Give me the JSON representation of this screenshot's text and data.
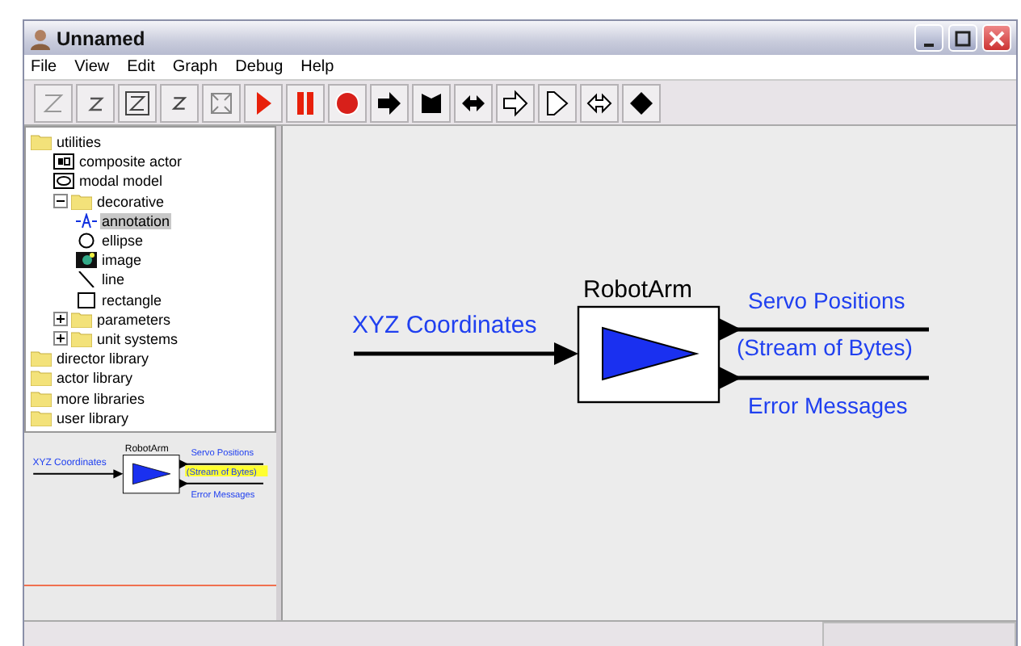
{
  "window": {
    "title": "Unnamed"
  },
  "menu": [
    "File",
    "View",
    "Edit",
    "Graph",
    "Debug",
    "Help"
  ],
  "library_tree": [
    {
      "label": "utilities",
      "kind": "folder",
      "selected": false,
      "children": [
        {
          "label": "composite actor",
          "kind": "composite",
          "selected": false
        },
        {
          "label": "modal model",
          "kind": "modal",
          "selected": false
        },
        {
          "label": "decorative",
          "kind": "folder",
          "expanded": true,
          "selected": false,
          "children": [
            {
              "label": "annotation",
              "kind": "annotation",
              "selected": true
            },
            {
              "label": "ellipse",
              "kind": "ellipse",
              "selected": false
            },
            {
              "label": "image",
              "kind": "image",
              "selected": false
            },
            {
              "label": "line",
              "kind": "line",
              "selected": false
            },
            {
              "label": "rectangle",
              "kind": "rectangle",
              "selected": false
            }
          ]
        },
        {
          "label": "parameters",
          "kind": "folder",
          "expanded": false,
          "selected": false
        },
        {
          "label": "unit systems",
          "kind": "folder",
          "expanded": false,
          "selected": false
        }
      ]
    },
    {
      "label": "director library",
      "kind": "folder",
      "selected": false
    },
    {
      "label": "actor library",
      "kind": "folder",
      "selected": false
    },
    {
      "label": "more libraries",
      "kind": "folder",
      "selected": false
    },
    {
      "label": "user library",
      "kind": "folder",
      "selected": false
    }
  ],
  "overview": {
    "actor": "RobotArm",
    "input_label": "XYZ Coordinates",
    "output_labels": [
      {
        "text": "Servo Positions",
        "highlighted": false
      },
      {
        "text": "(Stream of Bytes)",
        "highlighted": true
      },
      {
        "text": "Error Messages",
        "highlighted": false
      }
    ]
  },
  "canvas": {
    "actor": "RobotArm",
    "input_label": "XYZ Coordinates",
    "output_labels": [
      {
        "text": "Servo Positions",
        "highlighted": false
      },
      {
        "text": "(Stream of Bytes)",
        "highlighted": false
      },
      {
        "text": "Error Messages",
        "highlighted": false
      }
    ]
  }
}
